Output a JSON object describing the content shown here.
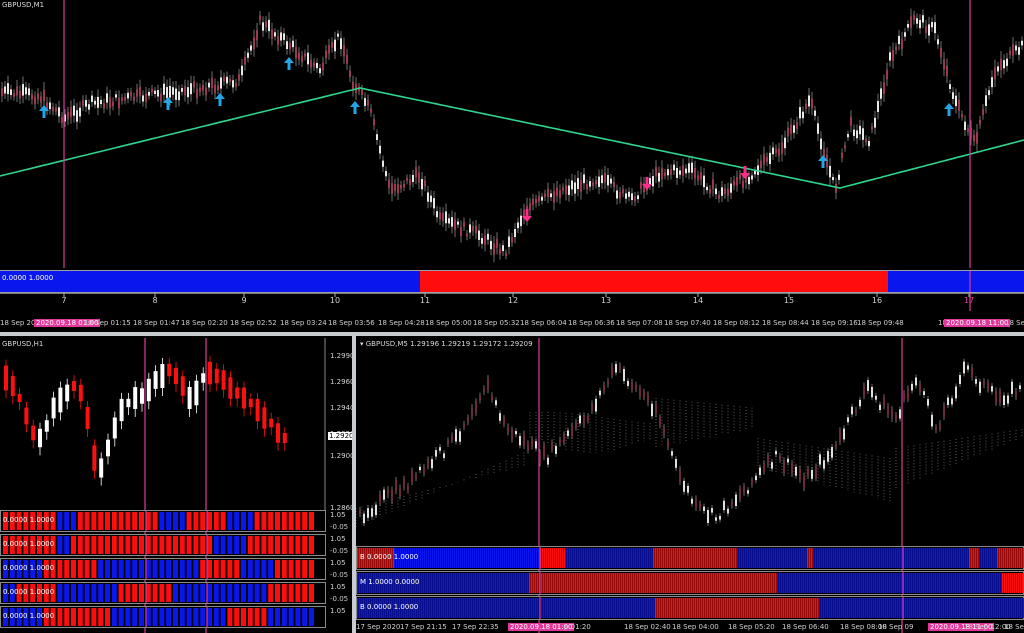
{
  "top": {
    "symbol": "GBPUSD,M1",
    "indicator_label": "0.0000 1.0000",
    "hour_labels": [
      "7",
      "8",
      "9",
      "10",
      "11",
      "12",
      "13",
      "14",
      "15",
      "16",
      "17"
    ],
    "time_ticks": [
      "18 Sep 2020",
      "2020.09.18 01:00",
      "18 Sep 01:15",
      "18 Sep 01:47",
      "18 Sep 02:20",
      "18 Sep 02:52",
      "18 Sep 03:24",
      "18 Sep 03:56",
      "18 Sep 04:28",
      "18 Sep 05:00",
      "18 Sep 05:32",
      "18 Sep 06:04",
      "18 Sep 06:36",
      "18 Sep 07:08",
      "18 Sep 07:40",
      "18 Sep 08:12",
      "18 Sep 08:44",
      "18 Sep 09:16",
      "18 Sep 09:48",
      "18",
      "2020.09.18 11:00",
      "18 Sep"
    ],
    "colors": {
      "ma": "#2ed58e",
      "up_arrow": "#22a6e6",
      "down_arrow": "#ff2d8a",
      "vline": "#e0389a",
      "blue": "#0a16ee",
      "red": "#ff0d0d"
    }
  },
  "h1": {
    "symbol": "GBPUSD,H1",
    "price_labels": [
      "1.2990",
      "1.2960",
      "1.2940",
      "1.2920",
      "1.2900",
      "1.2860"
    ],
    "current_price": "1.29209",
    "ind_labels": [
      "0.0000 1.0000",
      "0.0000 1.0000",
      "0.0000 1.0000",
      "0.0000 1.0000",
      "0.0000 1.0000"
    ],
    "scale_labels": [
      "1.05",
      "-0.05",
      "1.05",
      "-0.05",
      "1.05",
      "-0.05",
      "1.05",
      "-0.05",
      "1.05"
    ]
  },
  "m5": {
    "title": "GBPUSD,M5  1.29196 1.29219 1.29172 1.29209",
    "ind_labels": [
      "B 0.0000 1.0000",
      "M 1.0000 0.0000",
      "B 0.0000 1.0000"
    ],
    "time_ticks": [
      "17 Sep 2020",
      "17 Sep 21:15",
      "17 Sep 22:35",
      "2020.09.18 01:00",
      "p 01:20",
      "18 Sep 02:40",
      "18 Sep 04:00",
      "18 Sep 05:20",
      "18 Sep 06:40",
      "18 Sep 08:00",
      "18 Sep 09",
      "2020.09.18 11:00",
      "18 Sep 12:00",
      "18 Sep 13:2"
    ]
  }
}
